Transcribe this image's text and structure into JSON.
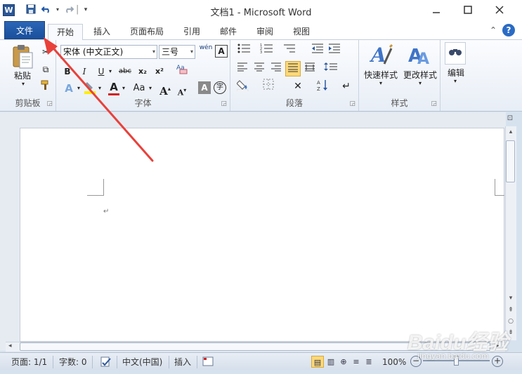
{
  "window": {
    "title": "文档1 - Microsoft Word",
    "logo_letter": "W"
  },
  "quick_access": {
    "icons": [
      "save-icon",
      "undo-icon",
      "redo-icon",
      "customize-icon"
    ]
  },
  "tabs": {
    "file": "文件",
    "items": [
      "开始",
      "插入",
      "页面布局",
      "引用",
      "邮件",
      "审阅",
      "视图"
    ],
    "active": "开始"
  },
  "ribbon": {
    "clipboard": {
      "paste_label": "粘贴",
      "group_label": "剪贴板"
    },
    "font": {
      "font_name": "宋体 (中文正文)",
      "font_size": "三号",
      "group_label": "字体",
      "bold": "B",
      "italic": "I",
      "underline": "U",
      "strike": "abc",
      "subscript": "x₂",
      "superscript": "x²",
      "grow": "A",
      "shrink": "A",
      "font_color_letter": "A",
      "case": "Aa",
      "wen": "wén",
      "char_border": "A",
      "enclose": "字"
    },
    "paragraph": {
      "group_label": "段落"
    },
    "styles": {
      "quick_styles": "快速样式",
      "change_styles": "更改样式",
      "group_label": "样式"
    },
    "editing": {
      "label": "编辑"
    }
  },
  "document": {
    "para_mark": "↵"
  },
  "status_bar": {
    "page": "页面: 1/1",
    "words": "字数: 0",
    "language": "中文(中国)",
    "insert_mode": "插入",
    "zoom": "100%",
    "zoom_minus": "−",
    "zoom_plus": "+"
  },
  "colors": {
    "file_tab": "#1a4f9c",
    "arrow": "#e8413a",
    "font_color_bar": "#d21f1f",
    "highlight_bar": "#ffee00"
  },
  "watermark": {
    "brand": "Baidu经验",
    "sub": "jingyan.baidu.com"
  }
}
